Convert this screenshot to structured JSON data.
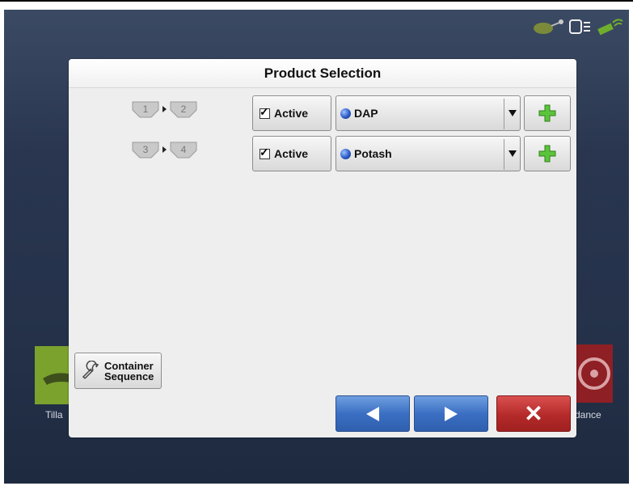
{
  "dialog": {
    "title": "Product Selection"
  },
  "rows": [
    {
      "bins": [
        "1",
        "2"
      ],
      "active_label": "Active",
      "active_checked": true,
      "product": "DAP"
    },
    {
      "bins": [
        "3",
        "4"
      ],
      "active_label": "Active",
      "active_checked": true,
      "product": "Potash"
    }
  ],
  "container_sequence": {
    "line1": "Container",
    "line2": "Sequence"
  },
  "background": {
    "left_tile_label": "Tilla",
    "right_tile_label": "dance"
  },
  "icons": {
    "status": [
      "implement-icon",
      "display-icon",
      "gps-signal-icon"
    ],
    "add": "plus-icon",
    "back": "arrow-left-icon",
    "next": "arrow-right-icon",
    "cancel": "close-icon",
    "product_dot": "blue-dot-icon",
    "wrench": "wrench-icon"
  },
  "colors": {
    "nav_blue": "#3b6fc3",
    "cancel_red": "#b52a2a",
    "add_green": "#5cc43a"
  }
}
